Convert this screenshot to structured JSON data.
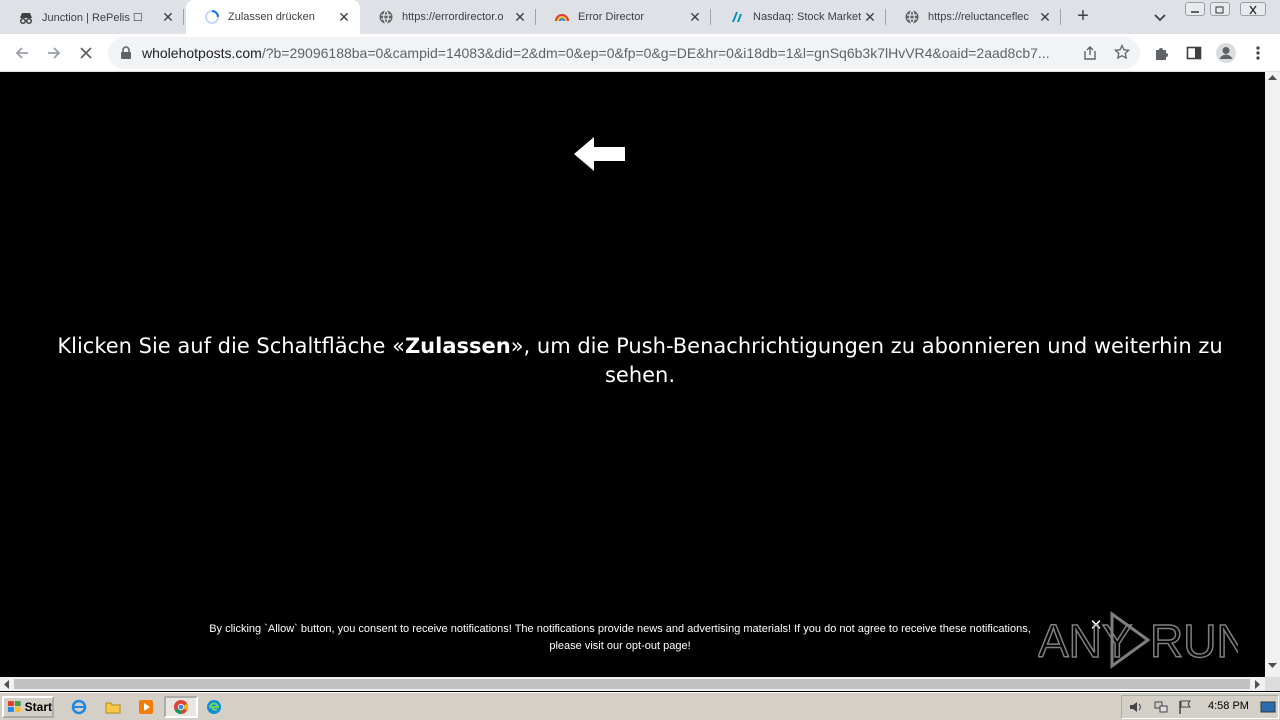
{
  "browser": {
    "tabs": [
      {
        "title": "Junction | RePelis ☐",
        "active": false,
        "icon": "spy-icon"
      },
      {
        "title": "Zulassen drücken",
        "active": true,
        "icon": "loading-icon"
      },
      {
        "title": "https://errordirector.o",
        "active": false,
        "icon": "globe-icon"
      },
      {
        "title": "Error Director",
        "active": false,
        "icon": "rainbow-icon"
      },
      {
        "title": "Nasdaq: Stock Market,",
        "active": false,
        "icon": "nasdaq-icon"
      },
      {
        "title": "https://reluctanceflec",
        "active": false,
        "icon": "globe-icon"
      }
    ],
    "url_host": "wholehotposts.com",
    "url_rest": "/?b=29096188ba=0&campid=14083&did=2&dm=0&ep=0&fp=0&g=DE&hr=0&i18db=1&l=gnSq6b3k7lHvVR4&oaid=2aad8cb7..."
  },
  "page": {
    "message_before": "Klicken Sie auf die Schaltfläche «",
    "message_bold": "Zulassen",
    "message_after": "», um die Push-Benachrichtigungen zu abonnieren und weiterhin zu sehen.",
    "consent_line1": "By clicking `Allow` button, you consent to receive notifications! The notifications provide news and advertising materials! If you do not agree to receive these notifications,",
    "consent_line2": "please visit our ",
    "consent_link": "opt-out page",
    "consent_end": "!",
    "watermark": "ANY RUN"
  },
  "taskbar": {
    "start_label": "Start",
    "clock": "4:58 PM"
  },
  "colors": {
    "background": "#000000",
    "text": "#ffffff",
    "tabbar": "#dee1e6"
  }
}
